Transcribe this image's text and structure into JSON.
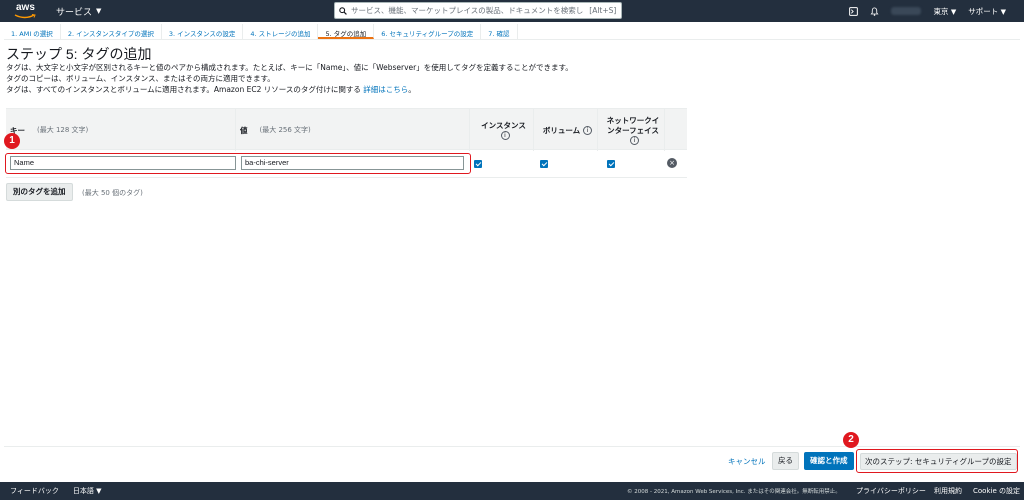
{
  "topbar": {
    "logo": "aws",
    "services": "サービス",
    "search_placeholder": "サービス、機能、マーケットプレイスの製品、ドキュメントを検索し",
    "search_shortcut": "[Alt+S]",
    "region": "東京",
    "support": "サポート"
  },
  "steps": [
    "1. AMI の選択",
    "2. インスタンスタイプの選択",
    "3. インスタンスの設定",
    "4. ストレージの追加",
    "5. タグの追加",
    "6. セキュリティグループの設定",
    "7. 確認"
  ],
  "page": {
    "title": "ステップ 5: タグの追加",
    "desc1": "タグは、大文字と小文字が区別されるキーと値のペアから構成されます。たとえば、キーに「Name」、値に「Webserver」を使用してタグを定義することができます。",
    "desc2": "タグのコピーは、ボリューム、インスタンス、またはその両方に適用できます。",
    "desc3": "タグは、すべてのインスタンスとボリュームに適用されます。Amazon EC2 リソースのタグ付けに関する",
    "desc3_link": "詳細はこちら",
    "desc3_end": "。"
  },
  "table": {
    "col_key": "キー",
    "col_key_hint": "(最大 128 文字)",
    "col_value": "値",
    "col_value_hint": "(最大 256 文字)",
    "col_instances": "インスタンス",
    "col_volumes": "ボリューム",
    "col_eni_1": "ネットワークイ",
    "col_eni_2": "ンターフェイス",
    "info_glyph": "i",
    "row": {
      "key": "Name",
      "value": "ba-chi-server",
      "instances": true,
      "volumes": true,
      "eni": true
    },
    "remove_glyph": "×"
  },
  "add_tag": {
    "label": "別のタグを追加",
    "hint": "(最大 50 個のタグ)"
  },
  "annotations": {
    "badge1": "1",
    "badge2": "2",
    "color": "#e0181f"
  },
  "actions": {
    "cancel": "キャンセル",
    "back": "戻る",
    "review": "確認と作成",
    "next": "次のステップ: セキュリティグループの設定"
  },
  "footer": {
    "feedback": "フィードバック",
    "language": "日本語",
    "copyright": "© 2008 - 2021, Amazon Web Services, Inc. またはその関連会社。無断転用禁止。",
    "privacy": "プライバシーポリシー",
    "terms": "利用規約",
    "cookies": "Cookie の設定"
  },
  "colors": {
    "nav_bg": "#232f3e",
    "link": "#0073bb",
    "primary": "#0073bb",
    "active_step": "#ec7211"
  }
}
